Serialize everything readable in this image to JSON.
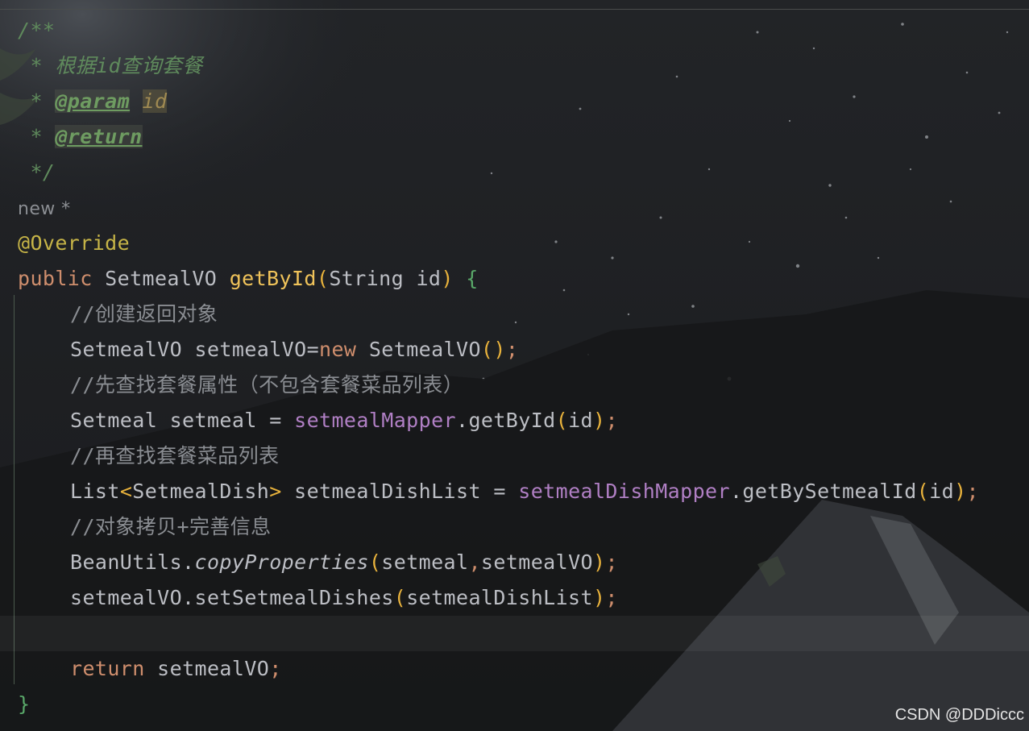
{
  "editor": {
    "javadoc": {
      "open": "/**",
      "star": "* ",
      "summary": "根据id查询套餐",
      "param_tag": "@param",
      "param_name": "id",
      "return_tag": "@return",
      "close": "*/"
    },
    "inlay_hint": "new *",
    "annotation": "@Override",
    "signature": {
      "modifier": "public",
      "return_type": "SetmealVO",
      "method": "getById",
      "open_paren": "(",
      "param_type": "String",
      "param": "id",
      "close_paren": ")",
      "open_brace": "{"
    },
    "body": {
      "c1": "//创建返回对象",
      "l1_type": "SetmealVO setmealVO=",
      "l1_new": "new",
      "l1_ctor": " SetmealVO",
      "l1_parens": "()",
      "c2": "//先查找套餐属性（不包含套餐菜品列表）",
      "l2_lhs": "Setmeal setmeal = ",
      "l2_field": "setmealMapper",
      "l2_call": ".getById",
      "l2_open": "(",
      "l2_arg": "id",
      "l2_close": ")",
      "c3": "//再查找套餐菜品列表",
      "l3_list": "List",
      "l3_lt": "<",
      "l3_generic": "SetmealDish",
      "l3_gt": ">",
      "l3_lhs": " setmealDishList = ",
      "l3_field": "setmealDishMapper",
      "l3_call": ".getBySetmealId",
      "l3_open": "(",
      "l3_arg": "id",
      "l3_close": ")",
      "c4": "//对象拷贝+完善信息",
      "l4_class": "BeanUtils.",
      "l4_method": "copyProperties",
      "l4_open": "(",
      "l4_arg1": "setmeal",
      "l4_comma": ",",
      "l4_arg2": "setmealVO",
      "l4_close": ")",
      "l5_call": "setmealVO.setSetmealDishes",
      "l5_open": "(",
      "l5_arg": "setmealDishList",
      "l5_close": ")",
      "return_kw": "return",
      "return_val": " setmealVO",
      "semicolon": ";",
      "close_brace": "}"
    }
  },
  "watermark": "CSDN @DDDiccc"
}
